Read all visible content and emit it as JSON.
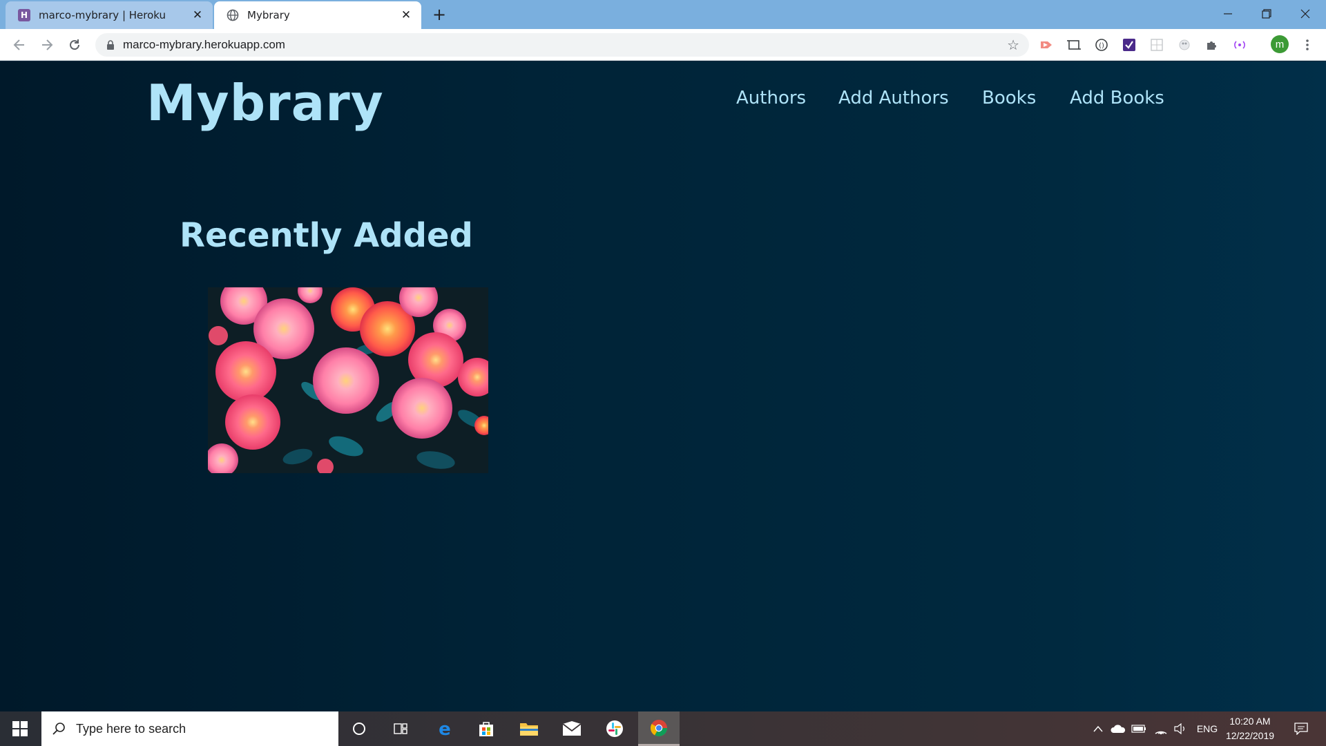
{
  "browser": {
    "tabs": [
      {
        "title": "marco-mybrary | Heroku",
        "favicon": "heroku-icon",
        "active": false
      },
      {
        "title": "Mybrary",
        "favicon": "globe-icon",
        "active": true
      }
    ],
    "url": "marco-mybrary.herokuapp.com",
    "profile_initial": "m",
    "extension_icons": [
      "pointer-extension-icon",
      "screenshot-extension-icon",
      "privacy-extension-icon",
      "checkmark-extension-icon",
      "grid-extension-icon",
      "bubble-extension-icon",
      "puzzle-icon",
      "broadcast-extension-icon"
    ]
  },
  "site": {
    "logo": "Mybrary",
    "nav": [
      "Authors",
      "Add Authors",
      "Books",
      "Add Books"
    ],
    "heading": "Recently Added",
    "book_cover": "flower-photo"
  },
  "taskbar": {
    "search_placeholder": "Type here to search",
    "apps": [
      "cortana-icon",
      "task-view-icon",
      "edge-icon",
      "store-icon",
      "file-explorer-icon",
      "mail-icon",
      "slack-icon",
      "chrome-icon"
    ],
    "tray": {
      "language": "ENG",
      "time": "10:20 AM",
      "date": "12/22/2019"
    }
  },
  "colors": {
    "page_bg": "#00263a",
    "accent_text": "#aee3f8",
    "tab_strip": "#7aafde"
  }
}
